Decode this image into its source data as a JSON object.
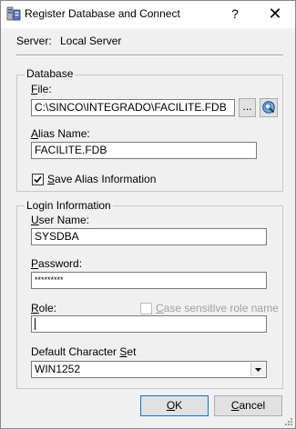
{
  "window": {
    "title": "Register Database and Connect",
    "help_label": "?",
    "close_label": "✕"
  },
  "server": {
    "label": "Server:",
    "value": "Local Server"
  },
  "database": {
    "group_title": "Database",
    "file_label_mnemonic": "F",
    "file_label_rest": "ile:",
    "file_value": "C:\\SINCO\\INTEGRADO\\FACILITE.FDB",
    "browse_label": "...",
    "alias_label_mnemonic": "A",
    "alias_label_rest": "lias Name:",
    "alias_value": "FACILITE.FDB",
    "save_alias_mnemonic": "S",
    "save_alias_rest": "ave Alias Information",
    "save_alias_checked": true
  },
  "login": {
    "group_title": "Login Information",
    "username_label_mnemonic": "U",
    "username_label_rest": "ser Name:",
    "username_value": "SYSDBA",
    "password_label_mnemonic": "P",
    "password_label_rest": "assword:",
    "password_masked": "*********",
    "role_label_mnemonic": "R",
    "role_label_rest": "ole:",
    "role_value": "",
    "case_sensitive_mnemonic": "C",
    "case_sensitive_rest": "ase sensitive role name",
    "case_sensitive_checked": false,
    "charset_label_pre": "Default Character ",
    "charset_label_mnemonic": "S",
    "charset_label_rest": "et",
    "charset_value": "WIN1252"
  },
  "buttons": {
    "ok_mnemonic": "O",
    "ok_rest": "K",
    "cancel_mnemonic": "C",
    "cancel_rest": "ancel"
  },
  "colors": {
    "dialog_bg": "#f0f0f0",
    "titlebar_bg": "#ffffff",
    "icon_blue": "#2a5db0"
  }
}
